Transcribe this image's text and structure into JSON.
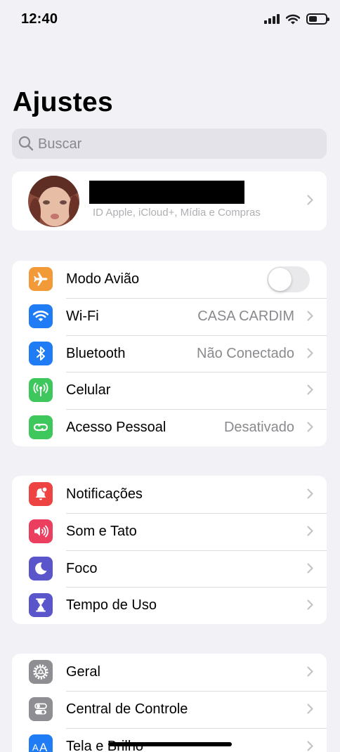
{
  "status_bar": {
    "time": "12:40",
    "icons": [
      "cellular-signal-icon",
      "wifi-icon",
      "battery-icon"
    ]
  },
  "title": "Ajustes",
  "search": {
    "placeholder": "Buscar",
    "icon": "search-icon"
  },
  "profile": {
    "subtitle": "ID Apple, iCloud+, Mídia e Compras"
  },
  "group1": {
    "airplane": {
      "label": "Modo Avião",
      "icon": "airplane-icon",
      "color": "#f29a37",
      "toggle": false
    },
    "wifi": {
      "label": "Wi-Fi",
      "value": "CASA CARDIM",
      "icon": "wifi-icon",
      "color": "#1f7cf5"
    },
    "bluetooth": {
      "label": "Bluetooth",
      "value": "Não Conectado",
      "icon": "bluetooth-icon",
      "color": "#1f7cf5"
    },
    "cellular": {
      "label": "Celular",
      "icon": "antenna-icon",
      "color": "#3dc75c"
    },
    "hotspot": {
      "label": "Acesso Pessoal",
      "value": "Desativado",
      "icon": "hotspot-icon",
      "color": "#3dc75c"
    }
  },
  "group2": {
    "notifications": {
      "label": "Notificações",
      "icon": "bell-icon",
      "color": "#ee4343"
    },
    "sounds": {
      "label": "Som e Tato",
      "icon": "speaker-icon",
      "color": "#ec3e5e"
    },
    "focus": {
      "label": "Foco",
      "icon": "moon-icon",
      "color": "#5b55cc"
    },
    "screen_time": {
      "label": "Tempo de Uso",
      "icon": "hourglass-icon",
      "color": "#5b55cc"
    }
  },
  "group3": {
    "general": {
      "label": "Geral",
      "icon": "gear-icon",
      "color": "#8e8e93"
    },
    "control_center": {
      "label": "Central de Controle",
      "icon": "switches-icon",
      "color": "#8e8e93"
    },
    "display": {
      "label": "Tela e Brilho",
      "icon": "text-size-icon",
      "color": "#1f7cf5"
    }
  }
}
